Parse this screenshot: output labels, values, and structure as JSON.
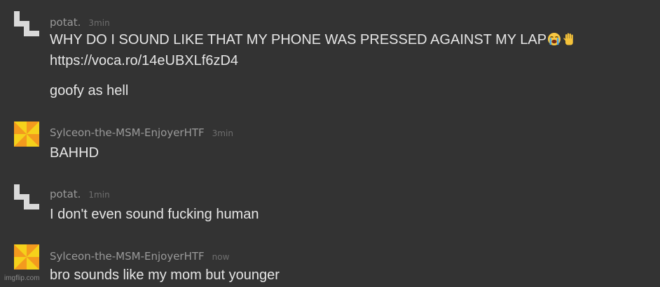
{
  "messages": [
    {
      "username": "potat.",
      "time": "3min",
      "avatar": "pixel-block-avatar",
      "lines": [
        {
          "text": "WHY DO I SOUND LIKE THAT MY PHONE WAS PRESSED AGAINST MY LAP",
          "emojis": [
            "loudly-crying-face",
            "raised-hand"
          ]
        },
        {
          "text": "https://voca.ro/14eUBXLf6zD4",
          "link": true
        },
        {
          "text": "goofy as hell"
        }
      ]
    },
    {
      "username": "Sylceon-the-MSM-EnjoyerHTF",
      "time": "3min",
      "avatar": "orange-pinwheel-avatar",
      "lines": [
        {
          "text": "BAHHD"
        }
      ]
    },
    {
      "username": "potat.",
      "time": "1min",
      "avatar": "pixel-block-avatar",
      "lines": [
        {
          "text": "I don't even sound fucking human"
        }
      ]
    },
    {
      "username": "Sylceon-the-MSM-EnjoyerHTF",
      "time": "now",
      "avatar": "orange-pinwheel-avatar",
      "lines": [
        {
          "text": "bro sounds like my mom but younger"
        }
      ]
    }
  ],
  "watermark": "imgflip.com",
  "colors": {
    "background": "#333333",
    "username": "#9a9a9a",
    "timestamp": "#6f6f6f",
    "message_text": "#e6e6e6",
    "pinwheel_orange": "#f39a1e",
    "pinwheel_yellow": "#f5d11b",
    "block_avatar": "#d9d9d9"
  }
}
